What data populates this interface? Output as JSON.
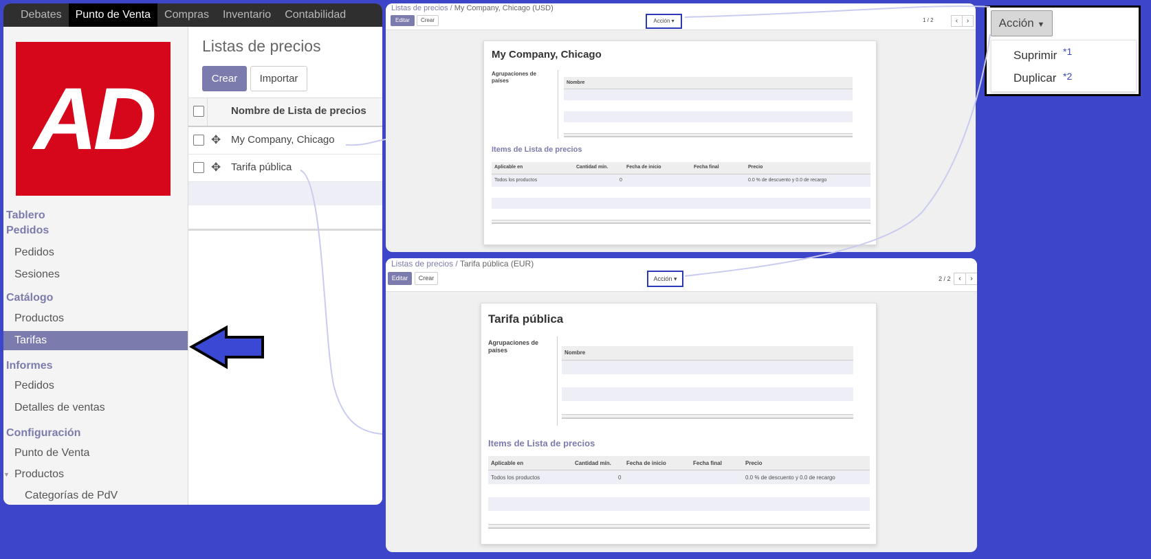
{
  "topnav": {
    "items": [
      {
        "label": "Debates",
        "active": false
      },
      {
        "label": "Punto de Venta",
        "active": true
      },
      {
        "label": "Compras",
        "active": false
      },
      {
        "label": "Inventario",
        "active": false
      },
      {
        "label": "Contabilidad",
        "active": false
      }
    ]
  },
  "logo": {
    "text": "AD",
    "color": "#d6071b"
  },
  "sidebar": {
    "tablero": "Tablero",
    "pedidos_head": "Pedidos",
    "pedidos": "Pedidos",
    "sesiones": "Sesiones",
    "catalogo_head": "Catálogo",
    "productos": "Productos",
    "tarifas": "Tarifas",
    "informes_head": "Informes",
    "informes_pedidos": "Pedidos",
    "detalles_ventas": "Detalles de ventas",
    "configuracion_head": "Configuración",
    "punto_de_venta": "Punto de Venta",
    "config_productos": "Productos",
    "categorias_pdv": "Categorías de PdV"
  },
  "list_view": {
    "title": "Listas de precios",
    "create_label": "Crear",
    "import_label": "Importar",
    "column_header": "Nombre de Lista de precios",
    "rows": [
      "My Company, Chicago",
      "Tarifa pública"
    ]
  },
  "form1": {
    "breadcrumb_link": "Listas de precios /",
    "breadcrumb_current": "My Company, Chicago (USD)",
    "edit_label": "Editar",
    "create_label": "Crear",
    "action_label": "Acción ▾",
    "pager": "1 / 2",
    "title": "My Company, Chicago",
    "country_groups_label": "Agrupaciones de países",
    "name_header": "Nombre",
    "items_section": "Items de Lista de precios",
    "columns": [
      "Aplicable en",
      "Cantidad mín.",
      "Fecha de inicio",
      "Fecha final",
      "Precio"
    ],
    "row": {
      "applied": "Todos los productos",
      "min_qty": "0",
      "price": "0.0 % de descuento y 0.0 de recargo"
    }
  },
  "form2": {
    "breadcrumb_link": "Listas de precios /",
    "breadcrumb_current": "Tarifa pública (EUR)",
    "edit_label": "Editar",
    "create_label": "Crear",
    "action_label": "Acción ▾",
    "pager": "2 / 2",
    "title": "Tarifa pública",
    "country_groups_label": "Agrupaciones de países",
    "name_header": "Nombre",
    "items_section": "Items de Lista de precios",
    "columns": [
      "Aplicable en",
      "Cantidad mín.",
      "Fecha de inicio",
      "Fecha final",
      "Precio"
    ],
    "row": {
      "applied": "Todos los productos",
      "min_qty": "0",
      "price": "0.0 % de descuento y 0.0 de recargo"
    }
  },
  "action_zoom": {
    "button_label": "Acción",
    "items": [
      {
        "label": "Suprimir",
        "mark": "*1"
      },
      {
        "label": "Duplicar",
        "mark": "*2"
      }
    ]
  },
  "colors": {
    "background": "#3d46c9",
    "accent": "#7c7bad",
    "highlight": "#2b37b5",
    "arrow": "#3a48d4"
  }
}
